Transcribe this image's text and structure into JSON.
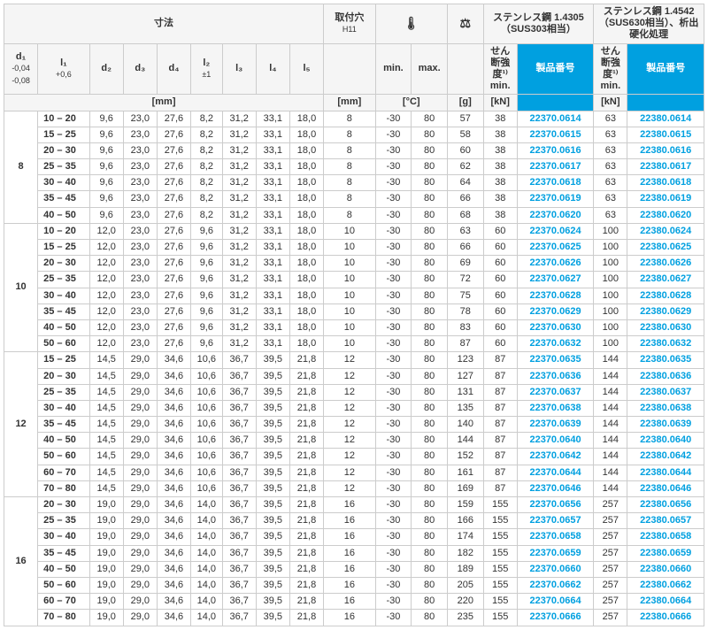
{
  "header": {
    "dimensions_label": "寸法",
    "mounting_hole": "取付穴",
    "mounting_hole_sub": "H11",
    "temp_icon": "🌡",
    "weight_icon": "⚖",
    "steel1": "ステンレス鋼 1.4305 （SUS303相当）",
    "steel2": "ステンレス鋼 1.4542 （SUS630相当）、析出硬化処理",
    "d1": "d₁",
    "d1_sub": "-0,04\n-0,08",
    "l1": "l₁",
    "l1_sub": "+0,6",
    "d2": "d₂",
    "d3": "d₃",
    "d4": "d₄",
    "l2": "l₂",
    "l2_sub": "±1",
    "l3": "l₃",
    "l4": "l₄",
    "l5": "l₅",
    "min": "min.",
    "max": "max.",
    "shear": "せん断強度¹⁾ min.",
    "part_no": "製品番号",
    "unit_mm": "[mm]",
    "unit_c": "[°C]",
    "unit_g": "[g]",
    "unit_kn": "[kN]"
  },
  "groups": [
    {
      "d1": "8",
      "rows": [
        {
          "l1": "10 – 20",
          "d2": "9,6",
          "d3": "23,0",
          "d4": "27,6",
          "l2": "8,2",
          "l3": "31,2",
          "l4": "33,1",
          "l5": "18,0",
          "mh": "8",
          "tmin": "-30",
          "tmax": "80",
          "g": "57",
          "s1": "38",
          "p1": "22370.0614",
          "s2": "63",
          "p2": "22380.0614"
        },
        {
          "l1": "15 – 25",
          "d2": "9,6",
          "d3": "23,0",
          "d4": "27,6",
          "l2": "8,2",
          "l3": "31,2",
          "l4": "33,1",
          "l5": "18,0",
          "mh": "8",
          "tmin": "-30",
          "tmax": "80",
          "g": "58",
          "s1": "38",
          "p1": "22370.0615",
          "s2": "63",
          "p2": "22380.0615"
        },
        {
          "l1": "20 – 30",
          "d2": "9,6",
          "d3": "23,0",
          "d4": "27,6",
          "l2": "8,2",
          "l3": "31,2",
          "l4": "33,1",
          "l5": "18,0",
          "mh": "8",
          "tmin": "-30",
          "tmax": "80",
          "g": "60",
          "s1": "38",
          "p1": "22370.0616",
          "s2": "63",
          "p2": "22380.0616"
        },
        {
          "l1": "25 – 35",
          "d2": "9,6",
          "d3": "23,0",
          "d4": "27,6",
          "l2": "8,2",
          "l3": "31,2",
          "l4": "33,1",
          "l5": "18,0",
          "mh": "8",
          "tmin": "-30",
          "tmax": "80",
          "g": "62",
          "s1": "38",
          "p1": "22370.0617",
          "s2": "63",
          "p2": "22380.0617"
        },
        {
          "l1": "30 – 40",
          "d2": "9,6",
          "d3": "23,0",
          "d4": "27,6",
          "l2": "8,2",
          "l3": "31,2",
          "l4": "33,1",
          "l5": "18,0",
          "mh": "8",
          "tmin": "-30",
          "tmax": "80",
          "g": "64",
          "s1": "38",
          "p1": "22370.0618",
          "s2": "63",
          "p2": "22380.0618"
        },
        {
          "l1": "35 – 45",
          "d2": "9,6",
          "d3": "23,0",
          "d4": "27,6",
          "l2": "8,2",
          "l3": "31,2",
          "l4": "33,1",
          "l5": "18,0",
          "mh": "8",
          "tmin": "-30",
          "tmax": "80",
          "g": "66",
          "s1": "38",
          "p1": "22370.0619",
          "s2": "63",
          "p2": "22380.0619"
        },
        {
          "l1": "40 – 50",
          "d2": "9,6",
          "d3": "23,0",
          "d4": "27,6",
          "l2": "8,2",
          "l3": "31,2",
          "l4": "33,1",
          "l5": "18,0",
          "mh": "8",
          "tmin": "-30",
          "tmax": "80",
          "g": "68",
          "s1": "38",
          "p1": "22370.0620",
          "s2": "63",
          "p2": "22380.0620"
        }
      ]
    },
    {
      "d1": "10",
      "rows": [
        {
          "l1": "10 – 20",
          "d2": "12,0",
          "d3": "23,0",
          "d4": "27,6",
          "l2": "9,6",
          "l3": "31,2",
          "l4": "33,1",
          "l5": "18,0",
          "mh": "10",
          "tmin": "-30",
          "tmax": "80",
          "g": "63",
          "s1": "60",
          "p1": "22370.0624",
          "s2": "100",
          "p2": "22380.0624"
        },
        {
          "l1": "15 – 25",
          "d2": "12,0",
          "d3": "23,0",
          "d4": "27,6",
          "l2": "9,6",
          "l3": "31,2",
          "l4": "33,1",
          "l5": "18,0",
          "mh": "10",
          "tmin": "-30",
          "tmax": "80",
          "g": "66",
          "s1": "60",
          "p1": "22370.0625",
          "s2": "100",
          "p2": "22380.0625"
        },
        {
          "l1": "20 – 30",
          "d2": "12,0",
          "d3": "23,0",
          "d4": "27,6",
          "l2": "9,6",
          "l3": "31,2",
          "l4": "33,1",
          "l5": "18,0",
          "mh": "10",
          "tmin": "-30",
          "tmax": "80",
          "g": "69",
          "s1": "60",
          "p1": "22370.0626",
          "s2": "100",
          "p2": "22380.0626"
        },
        {
          "l1": "25 – 35",
          "d2": "12,0",
          "d3": "23,0",
          "d4": "27,6",
          "l2": "9,6",
          "l3": "31,2",
          "l4": "33,1",
          "l5": "18,0",
          "mh": "10",
          "tmin": "-30",
          "tmax": "80",
          "g": "72",
          "s1": "60",
          "p1": "22370.0627",
          "s2": "100",
          "p2": "22380.0627"
        },
        {
          "l1": "30 – 40",
          "d2": "12,0",
          "d3": "23,0",
          "d4": "27,6",
          "l2": "9,6",
          "l3": "31,2",
          "l4": "33,1",
          "l5": "18,0",
          "mh": "10",
          "tmin": "-30",
          "tmax": "80",
          "g": "75",
          "s1": "60",
          "p1": "22370.0628",
          "s2": "100",
          "p2": "22380.0628"
        },
        {
          "l1": "35 – 45",
          "d2": "12,0",
          "d3": "23,0",
          "d4": "27,6",
          "l2": "9,6",
          "l3": "31,2",
          "l4": "33,1",
          "l5": "18,0",
          "mh": "10",
          "tmin": "-30",
          "tmax": "80",
          "g": "78",
          "s1": "60",
          "p1": "22370.0629",
          "s2": "100",
          "p2": "22380.0629"
        },
        {
          "l1": "40 – 50",
          "d2": "12,0",
          "d3": "23,0",
          "d4": "27,6",
          "l2": "9,6",
          "l3": "31,2",
          "l4": "33,1",
          "l5": "18,0",
          "mh": "10",
          "tmin": "-30",
          "tmax": "80",
          "g": "83",
          "s1": "60",
          "p1": "22370.0630",
          "s2": "100",
          "p2": "22380.0630"
        },
        {
          "l1": "50 – 60",
          "d2": "12,0",
          "d3": "23,0",
          "d4": "27,6",
          "l2": "9,6",
          "l3": "31,2",
          "l4": "33,1",
          "l5": "18,0",
          "mh": "10",
          "tmin": "-30",
          "tmax": "80",
          "g": "87",
          "s1": "60",
          "p1": "22370.0632",
          "s2": "100",
          "p2": "22380.0632"
        }
      ]
    },
    {
      "d1": "12",
      "rows": [
        {
          "l1": "15 – 25",
          "d2": "14,5",
          "d3": "29,0",
          "d4": "34,6",
          "l2": "10,6",
          "l3": "36,7",
          "l4": "39,5",
          "l5": "21,8",
          "mh": "12",
          "tmin": "-30",
          "tmax": "80",
          "g": "123",
          "s1": "87",
          "p1": "22370.0635",
          "s2": "144",
          "p2": "22380.0635"
        },
        {
          "l1": "20 – 30",
          "d2": "14,5",
          "d3": "29,0",
          "d4": "34,6",
          "l2": "10,6",
          "l3": "36,7",
          "l4": "39,5",
          "l5": "21,8",
          "mh": "12",
          "tmin": "-30",
          "tmax": "80",
          "g": "127",
          "s1": "87",
          "p1": "22370.0636",
          "s2": "144",
          "p2": "22380.0636"
        },
        {
          "l1": "25 – 35",
          "d2": "14,5",
          "d3": "29,0",
          "d4": "34,6",
          "l2": "10,6",
          "l3": "36,7",
          "l4": "39,5",
          "l5": "21,8",
          "mh": "12",
          "tmin": "-30",
          "tmax": "80",
          "g": "131",
          "s1": "87",
          "p1": "22370.0637",
          "s2": "144",
          "p2": "22380.0637"
        },
        {
          "l1": "30 – 40",
          "d2": "14,5",
          "d3": "29,0",
          "d4": "34,6",
          "l2": "10,6",
          "l3": "36,7",
          "l4": "39,5",
          "l5": "21,8",
          "mh": "12",
          "tmin": "-30",
          "tmax": "80",
          "g": "135",
          "s1": "87",
          "p1": "22370.0638",
          "s2": "144",
          "p2": "22380.0638"
        },
        {
          "l1": "35 – 45",
          "d2": "14,5",
          "d3": "29,0",
          "d4": "34,6",
          "l2": "10,6",
          "l3": "36,7",
          "l4": "39,5",
          "l5": "21,8",
          "mh": "12",
          "tmin": "-30",
          "tmax": "80",
          "g": "140",
          "s1": "87",
          "p1": "22370.0639",
          "s2": "144",
          "p2": "22380.0639"
        },
        {
          "l1": "40 – 50",
          "d2": "14,5",
          "d3": "29,0",
          "d4": "34,6",
          "l2": "10,6",
          "l3": "36,7",
          "l4": "39,5",
          "l5": "21,8",
          "mh": "12",
          "tmin": "-30",
          "tmax": "80",
          "g": "144",
          "s1": "87",
          "p1": "22370.0640",
          "s2": "144",
          "p2": "22380.0640"
        },
        {
          "l1": "50 – 60",
          "d2": "14,5",
          "d3": "29,0",
          "d4": "34,6",
          "l2": "10,6",
          "l3": "36,7",
          "l4": "39,5",
          "l5": "21,8",
          "mh": "12",
          "tmin": "-30",
          "tmax": "80",
          "g": "152",
          "s1": "87",
          "p1": "22370.0642",
          "s2": "144",
          "p2": "22380.0642"
        },
        {
          "l1": "60 – 70",
          "d2": "14,5",
          "d3": "29,0",
          "d4": "34,6",
          "l2": "10,6",
          "l3": "36,7",
          "l4": "39,5",
          "l5": "21,8",
          "mh": "12",
          "tmin": "-30",
          "tmax": "80",
          "g": "161",
          "s1": "87",
          "p1": "22370.0644",
          "s2": "144",
          "p2": "22380.0644"
        },
        {
          "l1": "70 – 80",
          "d2": "14,5",
          "d3": "29,0",
          "d4": "34,6",
          "l2": "10,6",
          "l3": "36,7",
          "l4": "39,5",
          "l5": "21,8",
          "mh": "12",
          "tmin": "-30",
          "tmax": "80",
          "g": "169",
          "s1": "87",
          "p1": "22370.0646",
          "s2": "144",
          "p2": "22380.0646"
        }
      ]
    },
    {
      "d1": "16",
      "rows": [
        {
          "l1": "20 – 30",
          "d2": "19,0",
          "d3": "29,0",
          "d4": "34,6",
          "l2": "14,0",
          "l3": "36,7",
          "l4": "39,5",
          "l5": "21,8",
          "mh": "16",
          "tmin": "-30",
          "tmax": "80",
          "g": "159",
          "s1": "155",
          "p1": "22370.0656",
          "s2": "257",
          "p2": "22380.0656"
        },
        {
          "l1": "25 – 35",
          "d2": "19,0",
          "d3": "29,0",
          "d4": "34,6",
          "l2": "14,0",
          "l3": "36,7",
          "l4": "39,5",
          "l5": "21,8",
          "mh": "16",
          "tmin": "-30",
          "tmax": "80",
          "g": "166",
          "s1": "155",
          "p1": "22370.0657",
          "s2": "257",
          "p2": "22380.0657"
        },
        {
          "l1": "30 – 40",
          "d2": "19,0",
          "d3": "29,0",
          "d4": "34,6",
          "l2": "14,0",
          "l3": "36,7",
          "l4": "39,5",
          "l5": "21,8",
          "mh": "16",
          "tmin": "-30",
          "tmax": "80",
          "g": "174",
          "s1": "155",
          "p1": "22370.0658",
          "s2": "257",
          "p2": "22380.0658"
        },
        {
          "l1": "35 – 45",
          "d2": "19,0",
          "d3": "29,0",
          "d4": "34,6",
          "l2": "14,0",
          "l3": "36,7",
          "l4": "39,5",
          "l5": "21,8",
          "mh": "16",
          "tmin": "-30",
          "tmax": "80",
          "g": "182",
          "s1": "155",
          "p1": "22370.0659",
          "s2": "257",
          "p2": "22380.0659"
        },
        {
          "l1": "40 – 50",
          "d2": "19,0",
          "d3": "29,0",
          "d4": "34,6",
          "l2": "14,0",
          "l3": "36,7",
          "l4": "39,5",
          "l5": "21,8",
          "mh": "16",
          "tmin": "-30",
          "tmax": "80",
          "g": "189",
          "s1": "155",
          "p1": "22370.0660",
          "s2": "257",
          "p2": "22380.0660"
        },
        {
          "l1": "50 – 60",
          "d2": "19,0",
          "d3": "29,0",
          "d4": "34,6",
          "l2": "14,0",
          "l3": "36,7",
          "l4": "39,5",
          "l5": "21,8",
          "mh": "16",
          "tmin": "-30",
          "tmax": "80",
          "g": "205",
          "s1": "155",
          "p1": "22370.0662",
          "s2": "257",
          "p2": "22380.0662"
        },
        {
          "l1": "60 – 70",
          "d2": "19,0",
          "d3": "29,0",
          "d4": "34,6",
          "l2": "14,0",
          "l3": "36,7",
          "l4": "39,5",
          "l5": "21,8",
          "mh": "16",
          "tmin": "-30",
          "tmax": "80",
          "g": "220",
          "s1": "155",
          "p1": "22370.0664",
          "s2": "257",
          "p2": "22380.0664"
        },
        {
          "l1": "70 – 80",
          "d2": "19,0",
          "d3": "29,0",
          "d4": "34,6",
          "l2": "14,0",
          "l3": "36,7",
          "l4": "39,5",
          "l5": "21,8",
          "mh": "16",
          "tmin": "-30",
          "tmax": "80",
          "g": "235",
          "s1": "155",
          "p1": "22370.0666",
          "s2": "257",
          "p2": "22380.0666"
        }
      ]
    }
  ]
}
